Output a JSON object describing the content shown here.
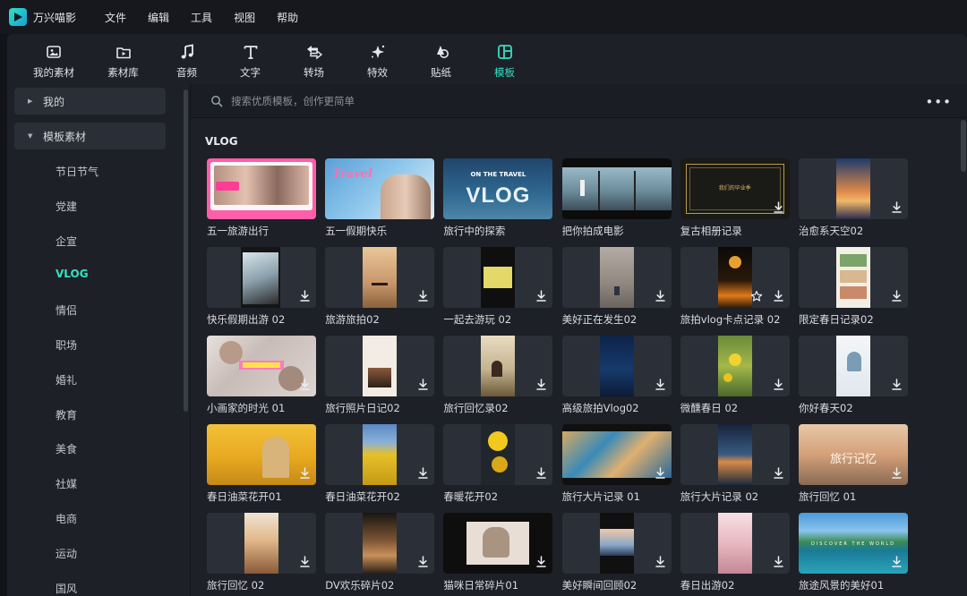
{
  "app": {
    "name": "万兴喵影"
  },
  "menu": [
    "文件",
    "编辑",
    "工具",
    "视图",
    "帮助"
  ],
  "toolbar": [
    {
      "label": "我的素材",
      "icon": "image-folder-icon"
    },
    {
      "label": "素材库",
      "icon": "media-library-icon"
    },
    {
      "label": "音频",
      "icon": "music-note-icon"
    },
    {
      "label": "文字",
      "icon": "text-t-icon"
    },
    {
      "label": "转场",
      "icon": "transition-arrows-icon"
    },
    {
      "label": "特效",
      "icon": "sparkle-effect-icon"
    },
    {
      "label": "贴纸",
      "icon": "sticker-icon"
    },
    {
      "label": "模板",
      "icon": "template-layout-icon"
    }
  ],
  "toolbar_active": "模板",
  "sidebar": {
    "groups": [
      {
        "label": "我的",
        "expanded": false
      },
      {
        "label": "模板素材",
        "expanded": true
      }
    ],
    "items": [
      "节日节气",
      "党建",
      "企宣",
      "VLOG",
      "情侣",
      "职场",
      "婚礼",
      "教育",
      "美食",
      "社媒",
      "电商",
      "运动",
      "国风"
    ],
    "active": "VLOG"
  },
  "search": {
    "placeholder": "搜索优质模板，创作更简单"
  },
  "section": {
    "title": "VLOG"
  },
  "colors": {
    "accent": "#35e0c2",
    "panel": "#1d2027",
    "bg": "#121419"
  },
  "templates": [
    {
      "title": "五一旅游出行",
      "style": "pink",
      "portrait": false,
      "download": false
    },
    {
      "title": "五一假期快乐",
      "style": "friends",
      "portrait": false,
      "download": false
    },
    {
      "title": "旅行中的探索",
      "style": "vlog-blue",
      "portrait": false,
      "download": false
    },
    {
      "title": "把你拍成电影",
      "style": "lighthouse",
      "portrait": false,
      "download": false
    },
    {
      "title": "复古相册记录",
      "style": "retro-gold",
      "portrait": false,
      "download": true
    },
    {
      "title": "治愈系天空02",
      "style": "sunset",
      "portrait": true,
      "download": true
    },
    {
      "title": "快乐假期出游 02",
      "style": "torn-photo",
      "portrait": true,
      "download": true
    },
    {
      "title": "旅游旅拍02",
      "style": "boat",
      "portrait": true,
      "download": true
    },
    {
      "title": "一起去游玩 02",
      "style": "yellow-note",
      "portrait": true,
      "download": true
    },
    {
      "title": "美好正在发生02",
      "style": "street",
      "portrait": true,
      "download": true
    },
    {
      "title": "旅拍vlog卡点记录 02",
      "style": "fireworks",
      "portrait": true,
      "download": true,
      "star": true
    },
    {
      "title": "限定春日记录02",
      "style": "collage",
      "portrait": true,
      "download": true
    },
    {
      "title": "小画家的时光 01",
      "style": "painter",
      "portrait": false,
      "download": true
    },
    {
      "title": "旅行照片日记02",
      "style": "diary",
      "portrait": true,
      "download": true
    },
    {
      "title": "旅行回忆录02",
      "style": "bike",
      "portrait": true,
      "download": true
    },
    {
      "title": "高级旅拍Vlog02",
      "style": "navy",
      "portrait": true,
      "download": true
    },
    {
      "title": "微醺春日 02",
      "style": "flower",
      "portrait": true,
      "download": true
    },
    {
      "title": "你好春天02",
      "style": "spring-girl",
      "portrait": true,
      "download": true
    },
    {
      "title": "春日油菜花开01",
      "style": "rape-wide",
      "portrait": false,
      "download": true
    },
    {
      "title": "春日油菜花开02",
      "style": "rape",
      "portrait": true,
      "download": true
    },
    {
      "title": "春暖花开02",
      "style": "yellow-flower",
      "portrait": true,
      "download": true
    },
    {
      "title": "旅行大片记录 01",
      "style": "aerial",
      "portrait": false,
      "download": true
    },
    {
      "title": "旅行大片记录 02",
      "style": "dusk-sea",
      "portrait": true,
      "download": true
    },
    {
      "title": "旅行回忆 01",
      "style": "haze",
      "portrait": false,
      "download": true
    },
    {
      "title": "旅行回忆 02",
      "style": "sun-road",
      "portrait": true,
      "download": true
    },
    {
      "title": "DV欢乐碎片02",
      "style": "dv",
      "portrait": true,
      "download": true
    },
    {
      "title": "猫咪日常碎片01",
      "style": "cat",
      "portrait": false,
      "download": true
    },
    {
      "title": "美好瞬间回顾02",
      "style": "sky-strip",
      "portrait": true,
      "download": true
    },
    {
      "title": "春日出游02",
      "style": "blossom",
      "portrait": true,
      "download": true
    },
    {
      "title": "旅途风景的美好01",
      "style": "lake",
      "portrait": false,
      "download": true
    }
  ]
}
